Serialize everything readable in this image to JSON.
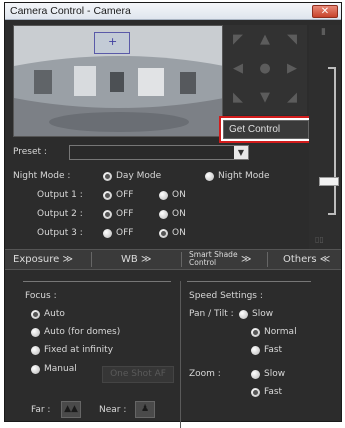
{
  "window": {
    "title": "Camera Control - Camera",
    "close_label": "✕"
  },
  "ptz": {
    "icons": [
      "arrow-up-left-icon",
      "arrow-up-icon",
      "arrow-up-right-icon",
      "arrow-left-icon",
      "home-icon",
      "arrow-right-icon",
      "arrow-down-left-icon",
      "arrow-down-icon",
      "arrow-down-right-icon"
    ]
  },
  "control": {
    "get_control_label": "Get Control"
  },
  "preset": {
    "label": "Preset :",
    "value": ""
  },
  "night_mode": {
    "label": "Night Mode :",
    "options": [
      "Day Mode",
      "Night Mode"
    ],
    "selected": "Day Mode"
  },
  "outputs": [
    {
      "label": "Output 1 :",
      "off": "OFF",
      "on": "ON",
      "selected": "OFF"
    },
    {
      "label": "Output 2 :",
      "off": "OFF",
      "on": "ON",
      "selected": "OFF"
    },
    {
      "label": "Output 3 :",
      "off": "OFF",
      "on": "ON",
      "selected": "ON"
    }
  ],
  "tabs": [
    {
      "label": "Exposure",
      "chevron": "≫"
    },
    {
      "label": "WB",
      "chevron": "≫"
    },
    {
      "label": "Smart Shade Control",
      "line1": "Smart Shade",
      "line2": "Control",
      "chevron": "≫"
    },
    {
      "label": "Others",
      "chevron": "≪"
    }
  ],
  "focus": {
    "label": "Focus :",
    "options": [
      "Auto",
      "Auto (for domes)",
      "Fixed at infinity",
      "Manual"
    ],
    "selected": "Auto",
    "one_shot_af": "One Shot AF",
    "far_label": "Far :",
    "near_label": "Near :"
  },
  "speed": {
    "label": "Speed Settings :",
    "pan_tilt_label": "Pan / Tilt :",
    "pan_tilt_options": [
      "Slow",
      "Normal",
      "Fast"
    ],
    "pan_tilt_selected": "Normal",
    "zoom_label": "Zoom :",
    "zoom_options": [
      "Slow",
      "Fast"
    ],
    "zoom_selected": "Fast"
  },
  "colors": {
    "panel_bg": "#2c2c2c",
    "highlight": "#d11c1c",
    "titlebar": "#dfe5ee"
  }
}
